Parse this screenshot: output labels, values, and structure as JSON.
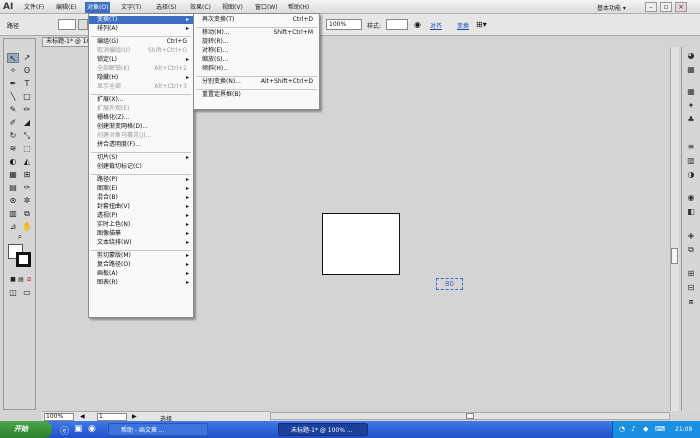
{
  "app": {
    "logo": "AI"
  },
  "menubar": {
    "items": [
      "文件(F)",
      "编辑(E)",
      "对象(O)",
      "文字(T)",
      "选择(S)",
      "效果(C)",
      "视图(V)",
      "窗口(W)",
      "帮助(H)"
    ],
    "workspace": "基本功能 ▾"
  },
  "controlbar": {
    "path_label": "路径",
    "opacity": "100%",
    "style_label": "样式:",
    "align_link": "对齐",
    "transform_link": "变换"
  },
  "document": {
    "tab_title": "未标题-1* @ 100%"
  },
  "statusbar": {
    "zoom": "100%",
    "artboard": "1",
    "tool": "选择"
  },
  "object_menu": {
    "items": [
      {
        "label": "变换(T)",
        "shortcut": "",
        "sub": true,
        "state": "highlight"
      },
      {
        "label": "排列(A)",
        "shortcut": "",
        "sub": true
      },
      {
        "sep": true
      },
      {
        "label": "编组(G)",
        "shortcut": "Ctrl+G"
      },
      {
        "label": "取消编组(U)",
        "shortcut": "Shift+Ctrl+G",
        "state": "disabled"
      },
      {
        "label": "锁定(L)",
        "shortcut": "",
        "sub": true
      },
      {
        "label": "全部解锁(K)",
        "shortcut": "Alt+Ctrl+2",
        "state": "disabled"
      },
      {
        "label": "隐藏(H)",
        "shortcut": "",
        "sub": true
      },
      {
        "label": "显示全部",
        "shortcut": "Alt+Ctrl+3",
        "state": "disabled"
      },
      {
        "sep": true
      },
      {
        "label": "扩展(X)...",
        "shortcut": ""
      },
      {
        "label": "扩展外观(E)",
        "shortcut": "",
        "state": "disabled"
      },
      {
        "label": "栅格化(Z)...",
        "shortcut": ""
      },
      {
        "label": "创建渐变网格(D)...",
        "shortcut": ""
      },
      {
        "label": "创建对象马赛克(J)...",
        "shortcut": "",
        "state": "disabled"
      },
      {
        "label": "拼合透明度(F)...",
        "shortcut": ""
      },
      {
        "sep": true
      },
      {
        "label": "切片(S)",
        "shortcut": "",
        "sub": true
      },
      {
        "label": "创建裁切标记(C)",
        "shortcut": ""
      },
      {
        "sep": true
      },
      {
        "label": "路径(P)",
        "shortcut": "",
        "sub": true
      },
      {
        "label": "图案(E)",
        "shortcut": "",
        "sub": true
      },
      {
        "label": "混合(B)",
        "shortcut": "",
        "sub": true
      },
      {
        "label": "封套扭曲(V)",
        "shortcut": "",
        "sub": true
      },
      {
        "label": "透视(P)",
        "shortcut": "",
        "sub": true
      },
      {
        "label": "实时上色(N)",
        "shortcut": "",
        "sub": true
      },
      {
        "label": "图像描摹",
        "shortcut": "",
        "sub": true
      },
      {
        "label": "文本绕排(W)",
        "shortcut": "",
        "sub": true
      },
      {
        "sep": true
      },
      {
        "label": "剪切蒙版(M)",
        "shortcut": "",
        "sub": true
      },
      {
        "label": "复合路径(O)",
        "shortcut": "",
        "sub": true
      },
      {
        "label": "画板(A)",
        "shortcut": "",
        "sub": true
      },
      {
        "label": "图表(R)",
        "shortcut": "",
        "sub": true
      }
    ]
  },
  "transform_menu": {
    "items": [
      {
        "label": "再次变换(T)",
        "shortcut": "Ctrl+D"
      },
      {
        "sep": true
      },
      {
        "label": "移动(M)...",
        "shortcut": "Shift+Ctrl+M"
      },
      {
        "label": "旋转(R)...",
        "shortcut": ""
      },
      {
        "label": "对称(E)...",
        "shortcut": ""
      },
      {
        "label": "缩放(S)...",
        "shortcut": ""
      },
      {
        "label": "倾斜(H)...",
        "shortcut": ""
      },
      {
        "sep": true
      },
      {
        "label": "分别变换(N)...",
        "shortcut": "Alt+Shift+Ctrl+D"
      },
      {
        "sep": true
      },
      {
        "label": "重置定界框(B)",
        "shortcut": ""
      }
    ]
  },
  "canvas": {
    "pasted_text": "80"
  },
  "taskbar": {
    "start": "开始",
    "tasks": [
      "帮助 - 画文章 ...",
      "未标题-1* @ 100% ..."
    ],
    "clock": "21:08"
  }
}
